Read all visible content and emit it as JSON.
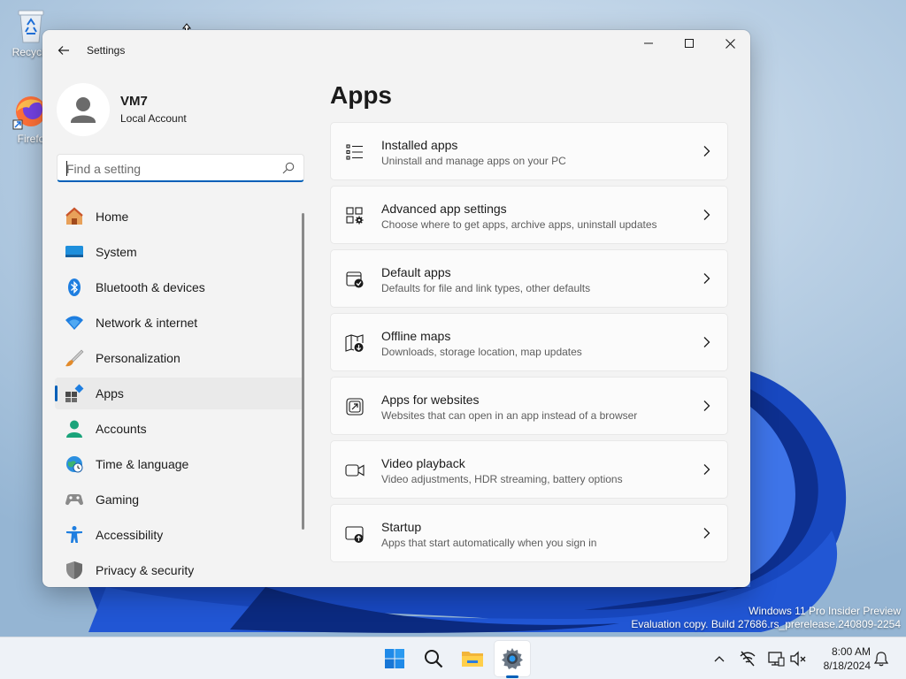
{
  "window": {
    "title": "Settings"
  },
  "profile": {
    "name": "VM7",
    "account_type": "Local Account"
  },
  "search": {
    "placeholder": "Find a setting"
  },
  "sidebar": {
    "items": [
      {
        "label": "Home",
        "icon": "home-icon"
      },
      {
        "label": "System",
        "icon": "system-icon"
      },
      {
        "label": "Bluetooth & devices",
        "icon": "bluetooth-icon"
      },
      {
        "label": "Network & internet",
        "icon": "wifi-icon"
      },
      {
        "label": "Personalization",
        "icon": "paintbrush-icon"
      },
      {
        "label": "Apps",
        "icon": "apps-icon",
        "selected": true
      },
      {
        "label": "Accounts",
        "icon": "person-icon"
      },
      {
        "label": "Time & language",
        "icon": "globe-clock-icon"
      },
      {
        "label": "Gaming",
        "icon": "gamepad-icon"
      },
      {
        "label": "Accessibility",
        "icon": "accessibility-icon"
      },
      {
        "label": "Privacy & security",
        "icon": "shield-icon"
      }
    ]
  },
  "main": {
    "title": "Apps",
    "cards": [
      {
        "title": "Installed apps",
        "subtitle": "Uninstall and manage apps on your PC",
        "icon": "list-icon"
      },
      {
        "title": "Advanced app settings",
        "subtitle": "Choose where to get apps, archive apps, uninstall updates",
        "icon": "app-settings-icon"
      },
      {
        "title": "Default apps",
        "subtitle": "Defaults for file and link types, other defaults",
        "icon": "default-apps-icon"
      },
      {
        "title": "Offline maps",
        "subtitle": "Downloads, storage location, map updates",
        "icon": "map-download-icon"
      },
      {
        "title": "Apps for websites",
        "subtitle": "Websites that can open in an app instead of a browser",
        "icon": "open-link-icon"
      },
      {
        "title": "Video playback",
        "subtitle": "Video adjustments, HDR streaming, battery options",
        "icon": "video-icon"
      },
      {
        "title": "Startup",
        "subtitle": "Apps that start automatically when you sign in",
        "icon": "startup-icon"
      }
    ]
  },
  "desktop": {
    "icons": [
      {
        "label": "Recycle",
        "icon": "recycle-bin-icon"
      },
      {
        "label": "Firefo",
        "icon": "firefox-icon"
      }
    ],
    "watermark": {
      "line1": "Windows 11 Pro Insider Preview",
      "line2": "Evaluation copy. Build 27686.rs_prerelease.240809-2254"
    }
  },
  "taskbar": {
    "apps": [
      "start-icon",
      "search-icon",
      "file-explorer-icon",
      "settings-gear-icon"
    ],
    "clock": {
      "time": "8:00 AM",
      "date": "8/18/2024"
    }
  },
  "colors": {
    "accent": "#005fb8",
    "window_bg": "#f3f3f3",
    "card_bg": "#fbfbfb"
  }
}
